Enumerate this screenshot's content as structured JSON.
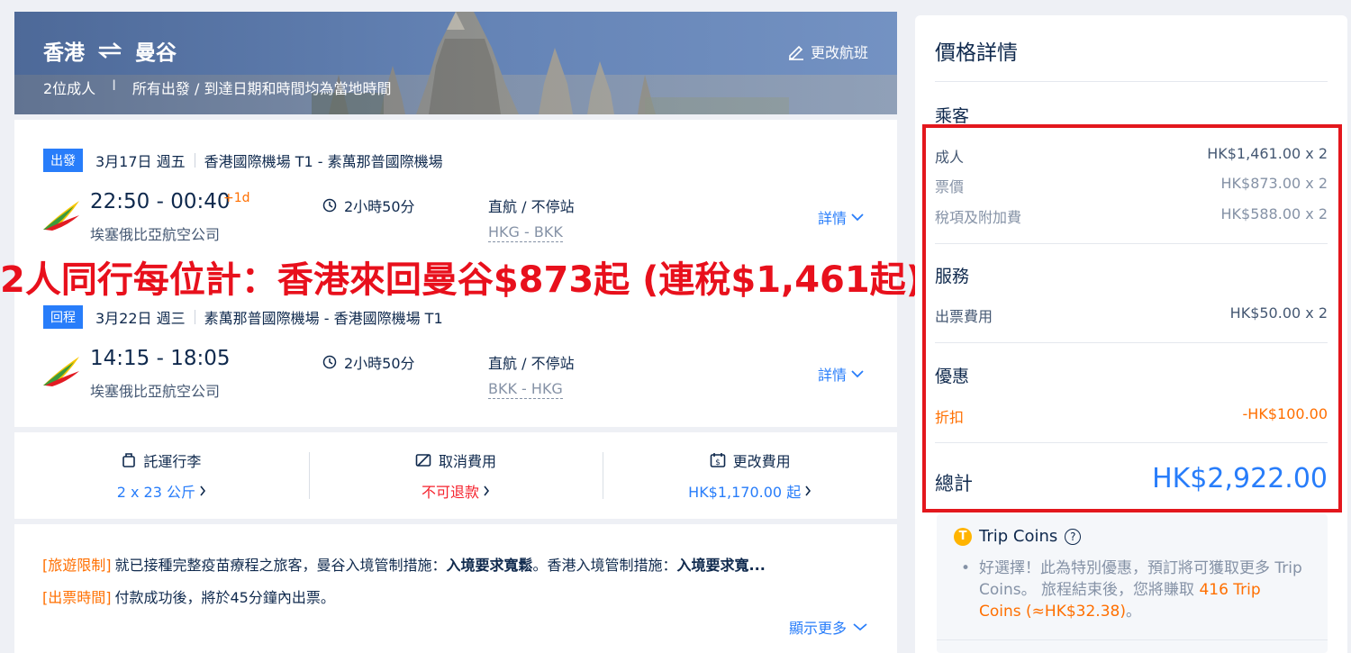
{
  "hero": {
    "origin": "香港",
    "destination": "曼谷",
    "passengers": "2位成人",
    "separator": "I",
    "note": "所有出發 / 到達日期和時間均為當地時間",
    "change_flight": "更改航班"
  },
  "outbound": {
    "badge": "出發",
    "date": "3月17日 週五",
    "airports": "香港國際機場 T1 - 素萬那普國際機場",
    "time": "22:50 - 00:40",
    "plus_day": "+1d",
    "airline": "埃塞俄比亞航空公司",
    "duration": "2小時50分",
    "stops": "直航 / 不停站",
    "route": "HKG - BKK",
    "details": "詳情"
  },
  "inbound": {
    "badge": "回程",
    "date": "3月22日 週三",
    "airports": "素萬那普國際機場 - 香港國際機場 T1",
    "time": "14:15 - 18:05",
    "airline": "埃塞俄比亞航空公司",
    "duration": "2小時50分",
    "stops": "直航 / 不停站",
    "route": "BKK - HKG",
    "details": "詳情"
  },
  "promo": "2人同行每位計：香港來回曼谷$873起 (連稅$1,461起)",
  "policies": [
    {
      "title": "託運行李",
      "value": "2 x 23 公斤"
    },
    {
      "title": "取消費用",
      "value": "不可退款"
    },
    {
      "title": "更改費用",
      "value": "HK$1,170.00 起"
    }
  ],
  "notice": {
    "line1_tag": "[旅遊限制]",
    "line1_a": "就已接種完整疫苗療程之旅客，曼谷入境管制措施：",
    "line1_b": "入境要求寬鬆",
    "line1_c": "。香港入境管制措施：",
    "line1_d": "入境要求寬...",
    "line2_tag": "[出票時間]",
    "line2": "付款成功後，將於45分鐘內出票。",
    "show_more": "顯示更多"
  },
  "price": {
    "title": "價格詳情",
    "passengers_head": "乘客",
    "adult_label": "成人",
    "adult_value": "HK$1,461.00 x 2",
    "fare_label": "票價",
    "fare_value": "HK$873.00 x 2",
    "tax_label": "稅項及附加費",
    "tax_value": "HK$588.00 x 2",
    "service_head": "服務",
    "ticket_fee_label": "出票費用",
    "ticket_fee_value": "HK$50.00 x 2",
    "offer_head": "優惠",
    "discount_label": "折扣",
    "discount_value": "-HK$100.00",
    "total_label": "總計",
    "total_value": "HK$2,922.00"
  },
  "coins": {
    "title": "Trip Coins",
    "text_a": "好選擇！此為特別優惠，預訂將可獲取更多 Trip Coins。 旅程結束後，您將賺取",
    "text_hl": "416 Trip Coins (≈HK$32.38)",
    "text_b": "。"
  },
  "colors": {
    "accent": "#287dfa",
    "promo_red": "#e8101c",
    "discount_orange": "#ff6f00"
  }
}
